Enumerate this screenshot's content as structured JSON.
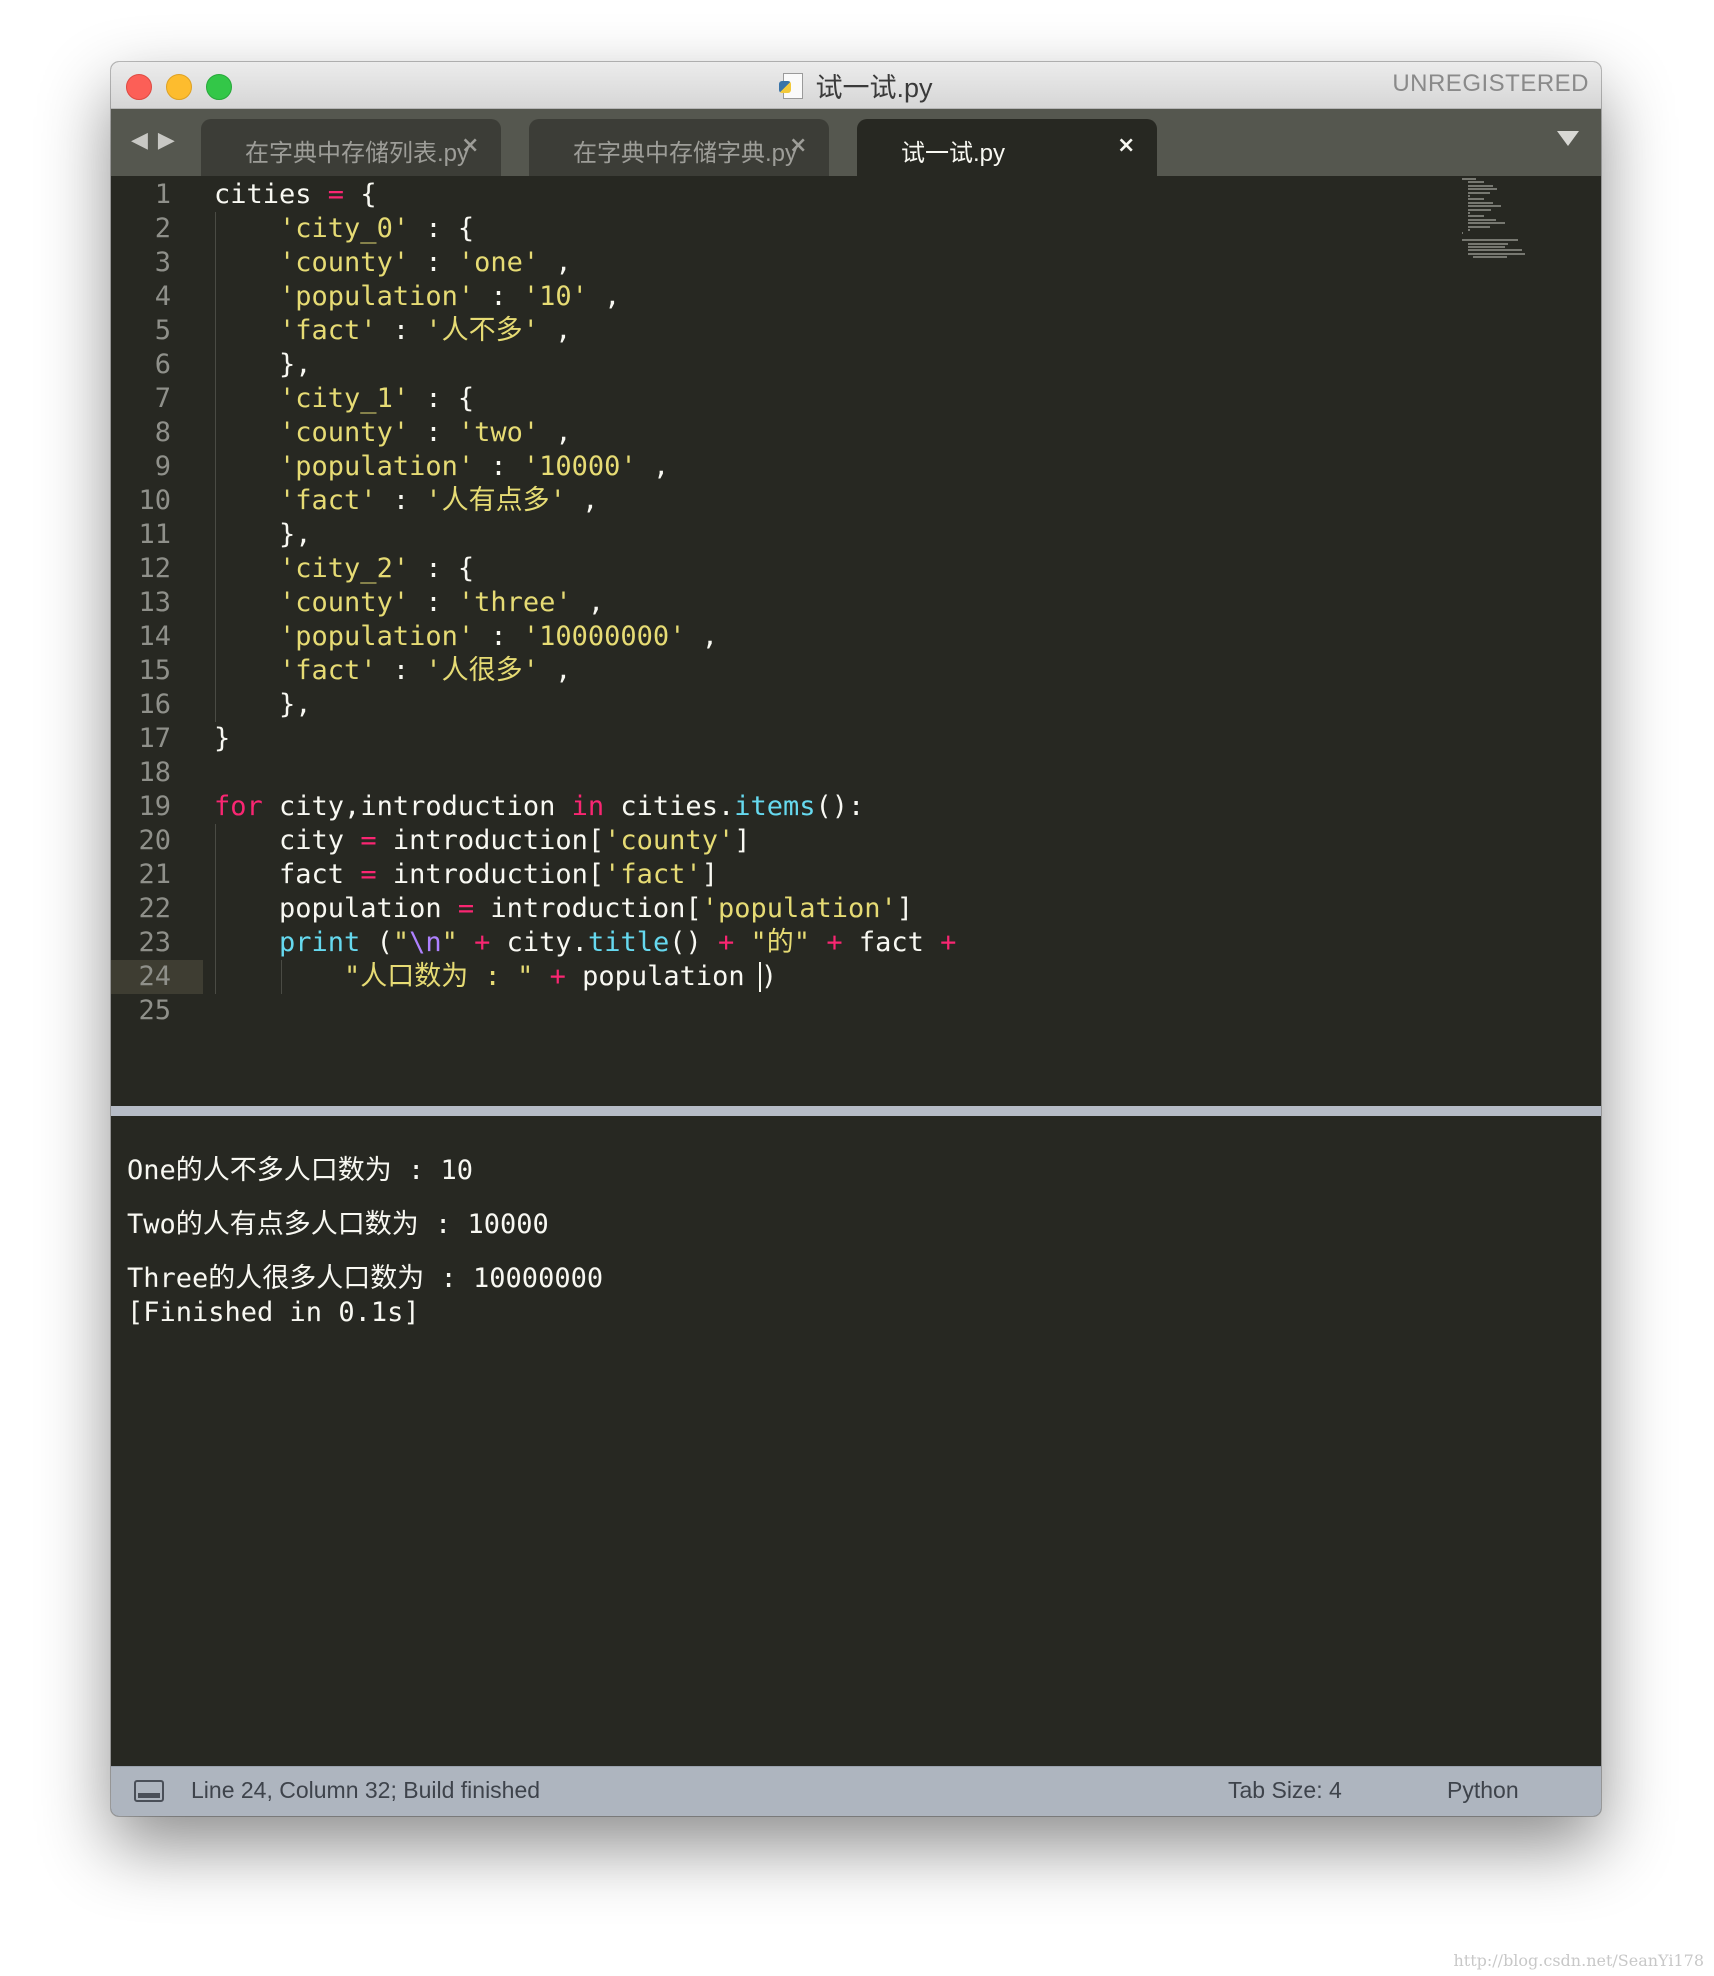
{
  "window": {
    "title": "试一试.py",
    "unregistered": "UNREGISTERED"
  },
  "tabs": [
    {
      "label": "在字典中存储列表.py",
      "active": false
    },
    {
      "label": "在字典中存储字典.py",
      "active": false
    },
    {
      "label": "试一试.py",
      "active": true
    }
  ],
  "tab_close_glyph": "×",
  "nav": {
    "back": "◀",
    "forward": "▶"
  },
  "editor": {
    "current_line": 24,
    "line_numbers": [
      "1",
      "2",
      "3",
      "4",
      "5",
      "6",
      "7",
      "8",
      "9",
      "10",
      "11",
      "12",
      "13",
      "14",
      "15",
      "16",
      "17",
      "18",
      "19",
      "20",
      "21",
      "22",
      "23",
      "24",
      "25"
    ],
    "code_lines": [
      [
        [
          "t",
          "cities "
        ],
        [
          "op",
          "="
        ],
        [
          "t",
          " {"
        ]
      ],
      [
        [
          "t",
          "    "
        ],
        [
          "str",
          "'city_0'"
        ],
        [
          "t",
          " : {"
        ]
      ],
      [
        [
          "t",
          "    "
        ],
        [
          "str",
          "'county'"
        ],
        [
          "t",
          " : "
        ],
        [
          "str",
          "'one'"
        ],
        [
          "t",
          " ,"
        ]
      ],
      [
        [
          "t",
          "    "
        ],
        [
          "str",
          "'population'"
        ],
        [
          "t",
          " : "
        ],
        [
          "str",
          "'10'"
        ],
        [
          "t",
          " ,"
        ]
      ],
      [
        [
          "t",
          "    "
        ],
        [
          "str",
          "'fact'"
        ],
        [
          "t",
          " : "
        ],
        [
          "str",
          "'人不多'"
        ],
        [
          "t",
          " ,"
        ]
      ],
      [
        [
          "t",
          "    },"
        ]
      ],
      [
        [
          "t",
          "    "
        ],
        [
          "str",
          "'city_1'"
        ],
        [
          "t",
          " : {"
        ]
      ],
      [
        [
          "t",
          "    "
        ],
        [
          "str",
          "'county'"
        ],
        [
          "t",
          " : "
        ],
        [
          "str",
          "'two'"
        ],
        [
          "t",
          " ,"
        ]
      ],
      [
        [
          "t",
          "    "
        ],
        [
          "str",
          "'population'"
        ],
        [
          "t",
          " : "
        ],
        [
          "str",
          "'10000'"
        ],
        [
          "t",
          " ,"
        ]
      ],
      [
        [
          "t",
          "    "
        ],
        [
          "str",
          "'fact'"
        ],
        [
          "t",
          " : "
        ],
        [
          "str",
          "'人有点多'"
        ],
        [
          "t",
          " ,"
        ]
      ],
      [
        [
          "t",
          "    },"
        ]
      ],
      [
        [
          "t",
          "    "
        ],
        [
          "str",
          "'city_2'"
        ],
        [
          "t",
          " : {"
        ]
      ],
      [
        [
          "t",
          "    "
        ],
        [
          "str",
          "'county'"
        ],
        [
          "t",
          " : "
        ],
        [
          "str",
          "'three'"
        ],
        [
          "t",
          " ,"
        ]
      ],
      [
        [
          "t",
          "    "
        ],
        [
          "str",
          "'population'"
        ],
        [
          "t",
          " : "
        ],
        [
          "str",
          "'10000000'"
        ],
        [
          "t",
          " ,"
        ]
      ],
      [
        [
          "t",
          "    "
        ],
        [
          "str",
          "'fact'"
        ],
        [
          "t",
          " : "
        ],
        [
          "str",
          "'人很多'"
        ],
        [
          "t",
          " ,"
        ]
      ],
      [
        [
          "t",
          "    },"
        ]
      ],
      [
        [
          "t",
          "}"
        ]
      ],
      [
        [
          "t",
          ""
        ]
      ],
      [
        [
          "kw",
          "for"
        ],
        [
          "t",
          " city,introduction "
        ],
        [
          "kw",
          "in"
        ],
        [
          "t",
          " cities."
        ],
        [
          "fn",
          "items"
        ],
        [
          "t",
          "():"
        ]
      ],
      [
        [
          "t",
          "    city "
        ],
        [
          "op",
          "="
        ],
        [
          "t",
          " introduction["
        ],
        [
          "str",
          "'county'"
        ],
        [
          "t",
          "]"
        ]
      ],
      [
        [
          "t",
          "    fact "
        ],
        [
          "op",
          "="
        ],
        [
          "t",
          " introduction["
        ],
        [
          "str",
          "'fact'"
        ],
        [
          "t",
          "]"
        ]
      ],
      [
        [
          "t",
          "    population "
        ],
        [
          "op",
          "="
        ],
        [
          "t",
          " introduction["
        ],
        [
          "str",
          "'population'"
        ],
        [
          "t",
          "]"
        ]
      ],
      [
        [
          "t",
          "    "
        ],
        [
          "fn",
          "print"
        ],
        [
          "t",
          " ("
        ],
        [
          "str",
          "\""
        ],
        [
          "esc",
          "\\n"
        ],
        [
          "str",
          "\""
        ],
        [
          "t",
          " "
        ],
        [
          "op",
          "+"
        ],
        [
          "t",
          " city."
        ],
        [
          "fn",
          "title"
        ],
        [
          "t",
          "() "
        ],
        [
          "op",
          "+"
        ],
        [
          "t",
          " "
        ],
        [
          "str",
          "\"的\""
        ],
        [
          "t",
          " "
        ],
        [
          "op",
          "+"
        ],
        [
          "t",
          " fact "
        ],
        [
          "op",
          "+"
        ]
      ],
      [
        [
          "t",
          "        "
        ],
        [
          "str",
          "\"人口数为 : \""
        ],
        [
          "t",
          " "
        ],
        [
          "op",
          "+"
        ],
        [
          "t",
          " population )"
        ]
      ],
      [
        [
          "t",
          ""
        ]
      ]
    ]
  },
  "output": {
    "lines": [
      "",
      "One的人不多人口数为 : 10",
      "",
      "Two的人有点多人口数为 : 10000",
      "",
      "Three的人很多人口数为 : 10000000",
      "[Finished in 0.1s]"
    ]
  },
  "status": {
    "position": "Line 24, Column 32; Build finished",
    "tab_size": "Tab Size: 4",
    "syntax": "Python"
  },
  "watermark": "http://blog.csdn.net/SeanYi178",
  "colors": {
    "background": "#272822",
    "keyword": "#f92672",
    "string": "#e6db74",
    "function": "#66d9ef",
    "escape": "#ae81ff",
    "text": "#f8f8f2"
  },
  "icons": {
    "close": "traffic-light-close",
    "minimize": "traffic-light-minimize",
    "maximize": "traffic-light-maximize",
    "file": "python-file-icon",
    "console": "console-panel-icon"
  }
}
